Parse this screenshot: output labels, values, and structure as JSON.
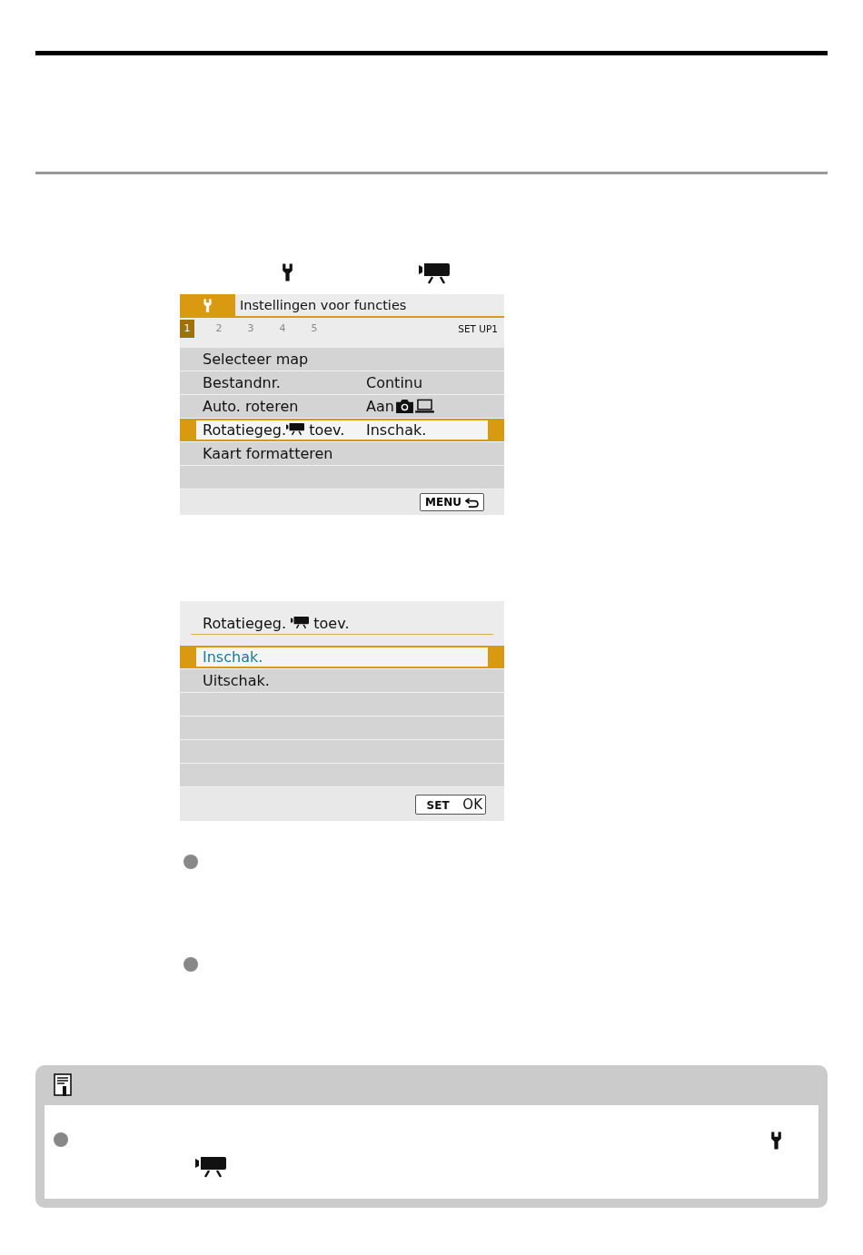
{
  "menu1": {
    "header": "Instellingen voor functies",
    "tabs": [
      {
        "label": "1",
        "selected": true
      },
      {
        "label": "2",
        "selected": false
      },
      {
        "label": "3",
        "selected": false
      },
      {
        "label": "4",
        "selected": false
      },
      {
        "label": "5",
        "selected": false
      }
    ],
    "set_label": "SET UP1",
    "items": [
      {
        "kind": "plain",
        "label": "Selecteer map",
        "selected": false
      },
      {
        "kind": "plain",
        "label": "Bestandnr.",
        "value": "Continu",
        "selected": false
      },
      {
        "kind": "devices",
        "label": "Auto. roteren",
        "value": "Aan",
        "selected": false
      },
      {
        "kind": "movie",
        "label": "Rotatiegeg.",
        "suffix": "toev.",
        "value": "Inschak.",
        "selected": true
      },
      {
        "kind": "plain",
        "label": "Kaart formatteren",
        "selected": false
      }
    ],
    "footer_button": "MENU"
  },
  "menu2": {
    "title": "Rotatiegeg.",
    "title_suffix": "toev.",
    "options": [
      {
        "label": "Inschak.",
        "selected": true
      },
      {
        "label": "Uitschak.",
        "selected": false
      }
    ],
    "set_key": "SET",
    "ok": "OK"
  }
}
